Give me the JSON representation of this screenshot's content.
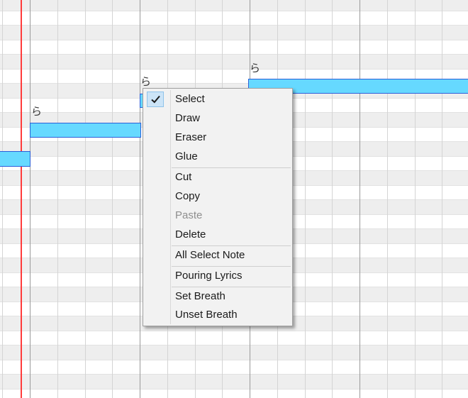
{
  "piano_roll": {
    "notes": [
      {
        "lyric": ""
      },
      {
        "lyric": "ら"
      },
      {
        "lyric": "ら"
      },
      {
        "lyric": "ら"
      }
    ]
  },
  "context_menu": {
    "items": [
      {
        "label": "Select",
        "checked": true,
        "enabled": true
      },
      {
        "label": "Draw",
        "enabled": true
      },
      {
        "label": "Eraser",
        "enabled": true
      },
      {
        "label": "Glue",
        "enabled": true
      },
      {
        "label": "Cut",
        "enabled": true
      },
      {
        "label": "Copy",
        "enabled": true
      },
      {
        "label": "Paste",
        "enabled": false
      },
      {
        "label": "Delete",
        "enabled": true
      },
      {
        "label": "All Select Note",
        "enabled": true
      },
      {
        "label": "Pouring Lyrics",
        "enabled": true
      },
      {
        "label": "Set Breath",
        "enabled": true
      },
      {
        "label": "Unset Breath",
        "enabled": true
      }
    ]
  },
  "colors": {
    "note_fill": "#66d9ff",
    "note_border": "#2b5fd8",
    "playhead": "#ff3b3b",
    "menu_background": "#f2f2f2",
    "check_highlight": "#cce4f7"
  },
  "icons": {
    "check": "check-icon"
  }
}
